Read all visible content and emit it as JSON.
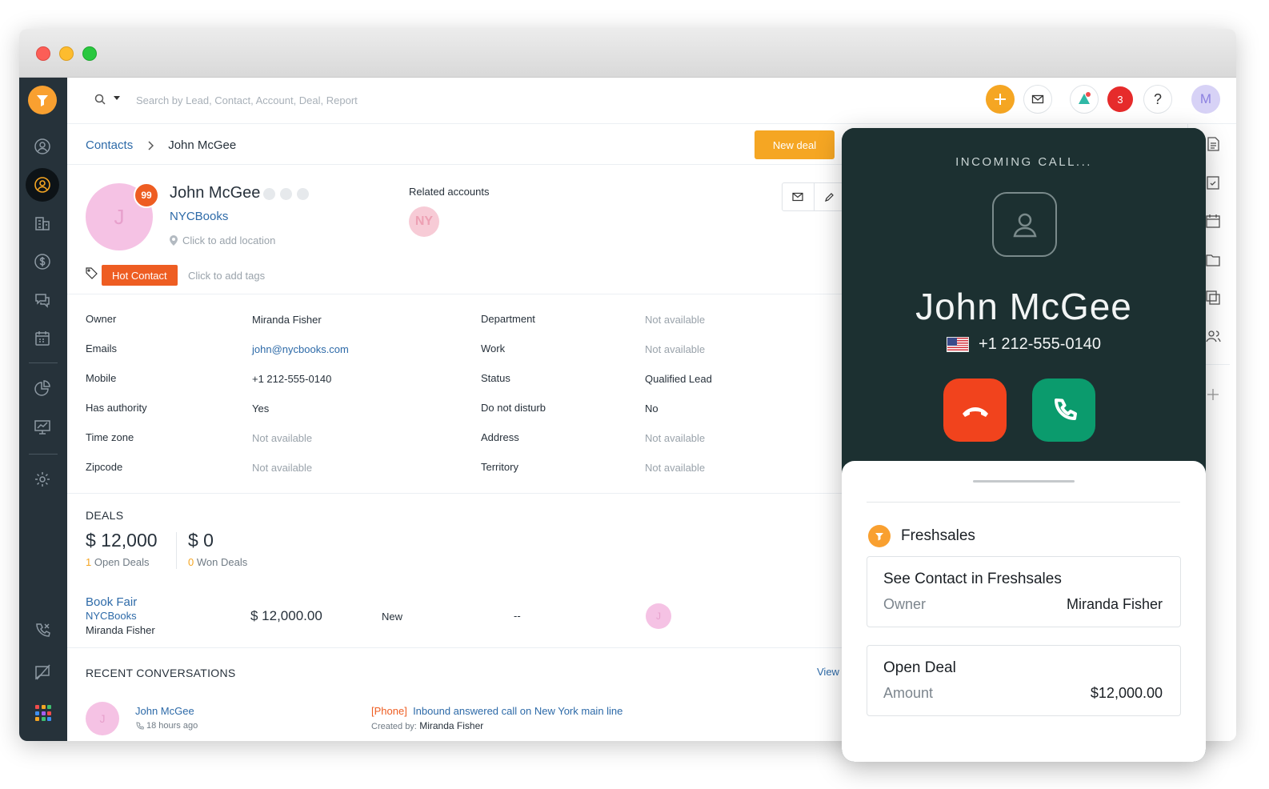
{
  "search": {
    "placeholder": "Search by Lead, Contact, Account, Deal, Report"
  },
  "topbar": {
    "notification_count": "3",
    "help_label": "?",
    "user_initial": "M"
  },
  "breadcrumb": {
    "parent": "Contacts",
    "current": "John McGee"
  },
  "actions": {
    "new_deal": "New deal"
  },
  "contact": {
    "initial": "J",
    "score": "99",
    "name": "John McGee",
    "company": "NYCBooks",
    "location_placeholder": "Click to add location",
    "related_title": "Related accounts",
    "related_initials": "NY",
    "tag": "Hot Contact",
    "tags_placeholder": "Click to add tags"
  },
  "fields_left": [
    {
      "label": "Owner",
      "value": "Miranda Fisher"
    },
    {
      "label": "Emails",
      "value": "john@nycbooks.com"
    },
    {
      "label": "Mobile",
      "value": "+1 212-555-0140"
    },
    {
      "label": "Has authority",
      "value": "Yes"
    },
    {
      "label": "Time zone",
      "value": "Not available"
    },
    {
      "label": "Zipcode",
      "value": "Not available"
    }
  ],
  "fields_right": [
    {
      "label": "Department",
      "value": "Not available"
    },
    {
      "label": "Work",
      "value": "Not available"
    },
    {
      "label": "Status",
      "value": "Qualified Lead"
    },
    {
      "label": "Do not disturb",
      "value": "No"
    },
    {
      "label": "Address",
      "value": "Not available"
    },
    {
      "label": "Territory",
      "value": "Not available"
    }
  ],
  "deals": {
    "title": "DEALS",
    "open_amount": "$ 12,000",
    "open_count": "1",
    "open_label": "Open Deals",
    "won_amount": "$ 0",
    "won_count": "0",
    "won_label": "Won Deals",
    "item": {
      "name": "Book Fair",
      "account": "NYCBooks",
      "owner": "Miranda Fisher",
      "value": "$ 12,000.00",
      "stage": "New",
      "close_date": "--",
      "owner_initial": "J"
    }
  },
  "conversations": {
    "title": "RECENT CONVERSATIONS",
    "view": "View",
    "item": {
      "initial": "J",
      "name": "John McGee",
      "time": "18 hours ago",
      "channel": "[Phone]",
      "summary": "Inbound answered call on New York main line",
      "created_by_label": "Created by:",
      "created_by": "Miranda Fisher"
    }
  },
  "call": {
    "status": "INCOMING CALL...",
    "caller_name": "John McGee",
    "caller_phone": "+1 212-555-0140",
    "app_name": "Freshsales",
    "contact_card": {
      "title": "See Contact in Freshsales",
      "label": "Owner",
      "value": "Miranda Fisher"
    },
    "deal_card": {
      "title": "Open Deal",
      "label": "Amount",
      "value": "$12,000.00"
    }
  },
  "colors": {
    "accent_orange": "#f5a623",
    "hot_tag": "#ee5d22",
    "link_blue": "#2d6aa8",
    "sidebar": "#26323a",
    "call_bg": "#1c3031",
    "decline": "#f1431d",
    "accept": "#0b9b6d"
  }
}
